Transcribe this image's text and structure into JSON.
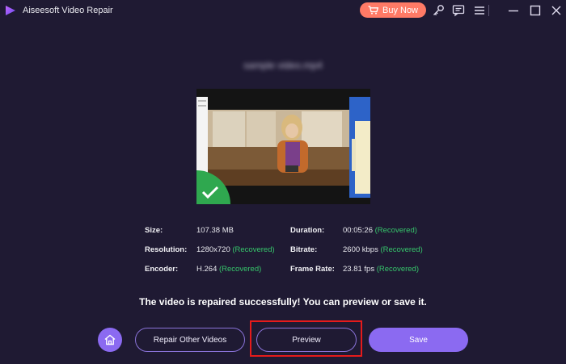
{
  "app": {
    "title": "Aiseesoft Video Repair",
    "buy_label": "Buy Now"
  },
  "file": {
    "name": "sample video.mp4"
  },
  "info": {
    "size_label": "Size:",
    "size_value": "107.38 MB",
    "resolution_label": "Resolution:",
    "resolution_value": "1280x720",
    "resolution_status": "(Recovered)",
    "encoder_label": "Encoder:",
    "encoder_value": "H.264",
    "encoder_status": "(Recovered)",
    "duration_label": "Duration:",
    "duration_value": "00:05:26",
    "duration_status": "(Recovered)",
    "bitrate_label": "Bitrate:",
    "bitrate_value": "2600 kbps",
    "bitrate_status": "(Recovered)",
    "framerate_label": "Frame Rate:",
    "framerate_value": "23.81 fps",
    "framerate_status": "(Recovered)"
  },
  "message": "The video is repaired successfully! You can preview or save it.",
  "buttons": {
    "repair_other": "Repair Other Videos",
    "preview": "Preview",
    "save": "Save"
  },
  "icons": {
    "logo": "play-logo-icon",
    "cart": "cart-icon",
    "key": "key-icon",
    "feedback": "chat-icon",
    "menu": "menu-icon",
    "minimize": "minimize-icon",
    "maximize": "maximize-icon",
    "close": "close-icon",
    "home": "home-icon",
    "check": "check-icon"
  },
  "colors": {
    "background": "#1f1a33",
    "accent": "#8b6af1",
    "buy": "#ff7a66",
    "recovered": "#36c56b",
    "highlight": "#e51b1b"
  }
}
